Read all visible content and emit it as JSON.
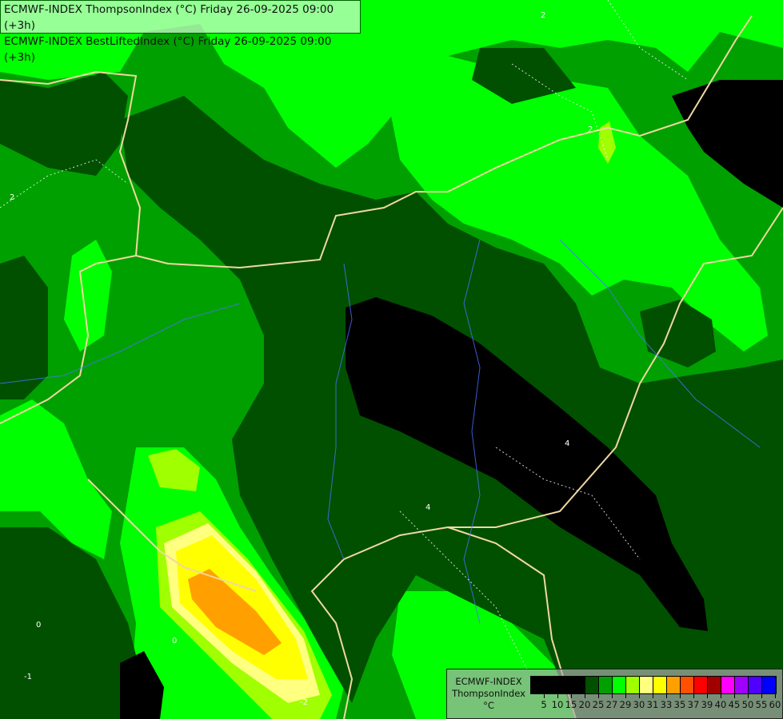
{
  "title": {
    "line1": "ECMWF-INDEX ThompsonIndex (°C) Friday 26-09-2025 09:00 (+3h)",
    "line2": "ECMWF-INDEX BestLiftedIndex (°C) Friday 26-09-2025 09:00 (+3h)"
  },
  "legend": {
    "model": "ECMWF-INDEX",
    "variable": "ThompsonIndex",
    "unit": "°C",
    "labels": [
      "5",
      "10",
      "15",
      "20",
      "25",
      "27",
      "29",
      "30",
      "31",
      "33",
      "35",
      "37",
      "39",
      "40",
      "45",
      "50",
      "55",
      "60"
    ],
    "colors": [
      "#000000",
      "#000000",
      "#000000",
      "#000000",
      "#005000",
      "#00a000",
      "#00ff00",
      "#a0ff00",
      "#ffff80",
      "#ffff00",
      "#ffa000",
      "#ff5000",
      "#ff0000",
      "#a00000",
      "#ff00ff",
      "#a000ff",
      "#5000ff",
      "#0000ff"
    ]
  },
  "contour_labels": [
    "2",
    "2",
    "2",
    "4",
    "4",
    "0",
    "0",
    "-1",
    "-2"
  ]
}
